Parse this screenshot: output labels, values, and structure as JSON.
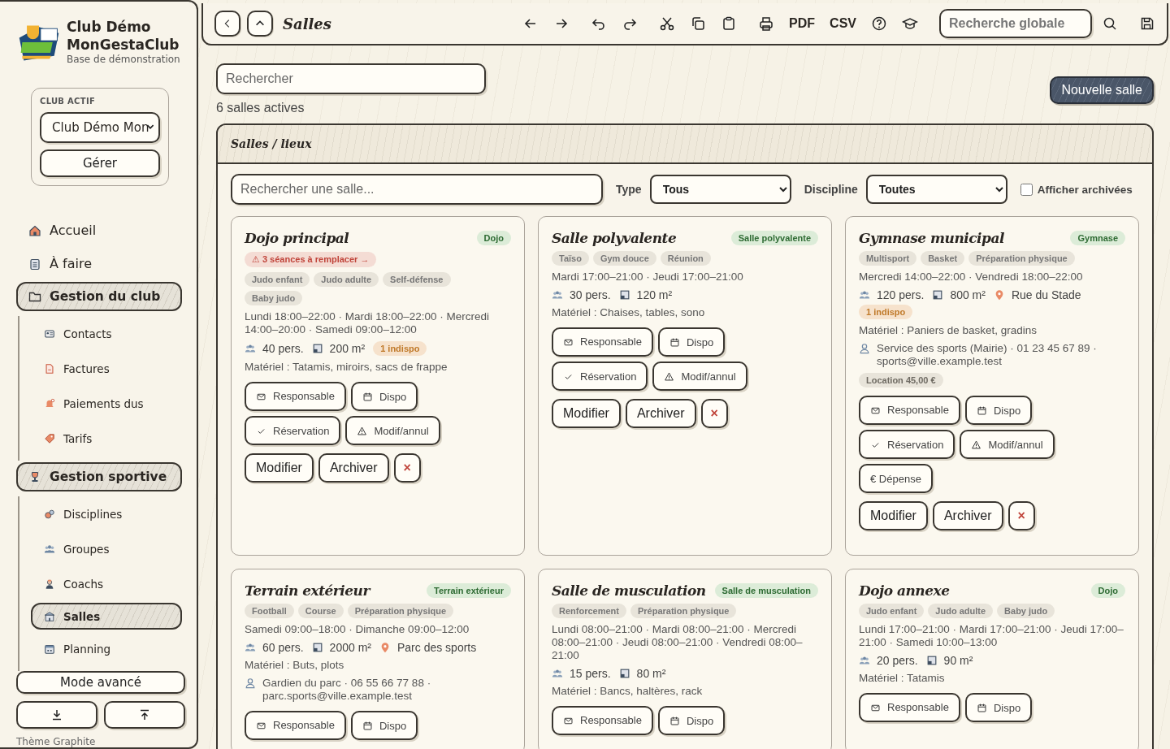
{
  "sidebar": {
    "brand": {
      "name": "Club Démo MonGestaClub",
      "subtitle": "Base de démonstration"
    },
    "active_club": {
      "label": "CLUB ACTIF",
      "value": "Club Démo Mon",
      "manage_button": "Gérer"
    },
    "nav": [
      {
        "kind": "link",
        "label": "Accueil",
        "selected": false
      },
      {
        "kind": "link",
        "label": "À faire",
        "selected": false
      },
      {
        "kind": "group",
        "label": "Gestion du club",
        "children": [
          {
            "label": "Contacts",
            "selected": false
          },
          {
            "label": "Factures",
            "selected": false
          },
          {
            "label": "Paiements dus",
            "selected": false
          },
          {
            "label": "Tarifs",
            "selected": false
          }
        ]
      },
      {
        "kind": "group",
        "label": "Gestion sportive",
        "children": [
          {
            "label": "Disciplines",
            "selected": false
          },
          {
            "label": "Groupes",
            "selected": false
          },
          {
            "label": "Coachs",
            "selected": false
          },
          {
            "label": "Salles",
            "selected": true
          },
          {
            "label": "Planning",
            "selected": false
          }
        ]
      }
    ],
    "mode_button": "Mode avancé",
    "theme": "Thème Graphite"
  },
  "toolbar": {
    "title": "Salles",
    "pdf": "PDF",
    "csv": "CSV",
    "search": {
      "placeholder": "Recherche globale"
    }
  },
  "page": {
    "search": {
      "placeholder": "Rechercher"
    },
    "count": "6 salles actives",
    "new_button": "Nouvelle salle"
  },
  "panel": {
    "title": "Salles / lieux",
    "search": {
      "placeholder": "Rechercher une salle..."
    },
    "type_label": "Type",
    "type_value": "Tous",
    "discipline_label": "Discipline",
    "discipline_value": "Toutes",
    "archived": {
      "label": "Afficher archivées",
      "checked": false
    },
    "cards": [
      {
        "name": "Dojo principal",
        "badge": "Dojo",
        "alert": "⚠ 3 séances à remplacer →",
        "tags": [
          "Judo enfant",
          "Judo adulte",
          "Self-défense",
          "Baby judo"
        ],
        "schedule": "Lundi 18:00–22:00 · Mardi 18:00–22:00 · Mercredi 14:00–20:00 · Samedi 09:00–12:00",
        "capacity": "40 pers.",
        "area": "200 m²",
        "unavailable": "1 indispo",
        "equipment": "Matériel : Tatamis, miroirs, sacs de frappe",
        "actions": [
          {
            "kind": "contact",
            "label": "Responsable"
          },
          {
            "kind": "availability",
            "label": "Dispo"
          },
          {
            "kind": "booking",
            "label": "Réservation"
          },
          {
            "kind": "change",
            "label": "Modif/annul"
          }
        ],
        "main_actions": [
          {
            "kind": "edit",
            "label": "Modifier"
          },
          {
            "kind": "archive",
            "label": "Archiver"
          },
          {
            "kind": "delete",
            "label": "×"
          }
        ]
      },
      {
        "name": "Salle polyvalente",
        "badge": "Salle polyvalente",
        "tags": [
          "Taïso",
          "Gym douce",
          "Réunion"
        ],
        "schedule": "Mardi 17:00–21:00 · Jeudi 17:00–21:00",
        "capacity": "30 pers.",
        "area": "120 m²",
        "equipment": "Matériel : Chaises, tables, sono",
        "actions": [
          {
            "kind": "contact",
            "label": "Responsable"
          },
          {
            "kind": "availability",
            "label": "Dispo"
          },
          {
            "kind": "booking",
            "label": "Réservation"
          },
          {
            "kind": "change",
            "label": "Modif/annul"
          }
        ],
        "main_actions": [
          {
            "kind": "edit",
            "label": "Modifier"
          },
          {
            "kind": "archive",
            "label": "Archiver"
          },
          {
            "kind": "delete",
            "label": "×"
          }
        ]
      },
      {
        "name": "Gymnase municipal",
        "badge": "Gymnase",
        "tags": [
          "Multisport",
          "Basket",
          "Préparation physique"
        ],
        "schedule": "Mercredi 14:00–22:00 · Vendredi 18:00–22:00",
        "capacity": "120 pers.",
        "area": "800 m²",
        "location": "Rue du Stade",
        "unavailable": "1 indispo",
        "equipment": "Matériel : Paniers de basket, gradins",
        "contact": "Service des sports (Mairie) · 01 23 45 67 89 · sports@ville.example.test",
        "price": "Location 45,00 €",
        "actions": [
          {
            "kind": "contact",
            "label": "Responsable"
          },
          {
            "kind": "availability",
            "label": "Dispo"
          },
          {
            "kind": "booking",
            "label": "Réservation"
          },
          {
            "kind": "change",
            "label": "Modif/annul"
          },
          {
            "kind": "expense",
            "label": "€ Dépense"
          }
        ],
        "main_actions": [
          {
            "kind": "edit",
            "label": "Modifier"
          },
          {
            "kind": "archive",
            "label": "Archiver"
          },
          {
            "kind": "delete",
            "label": "×"
          }
        ]
      },
      {
        "name": "Terrain extérieur",
        "badge": "Terrain extérieur",
        "tags": [
          "Football",
          "Course",
          "Préparation physique"
        ],
        "schedule": "Samedi 09:00–18:00 · Dimanche 09:00–12:00",
        "capacity": "60 pers.",
        "area": "2000 m²",
        "location": "Parc des sports",
        "equipment": "Matériel : Buts, plots",
        "contact": "Gardien du parc · 06 55 66 77 88 · parc.sports@ville.example.test",
        "actions": [
          {
            "kind": "contact",
            "label": "Responsable"
          },
          {
            "kind": "availability",
            "label": "Dispo"
          }
        ]
      },
      {
        "name": "Salle de musculation",
        "badge": "Salle de musculation",
        "tags": [
          "Renforcement",
          "Préparation physique"
        ],
        "schedule": "Lundi 08:00–21:00 · Mardi 08:00–21:00 · Mercredi 08:00–21:00 · Jeudi 08:00–21:00 · Vendredi 08:00–21:00",
        "capacity": "15 pers.",
        "area": "80 m²",
        "equipment": "Matériel : Bancs, haltères, rack",
        "actions": [
          {
            "kind": "contact",
            "label": "Responsable"
          },
          {
            "kind": "availability",
            "label": "Dispo"
          }
        ]
      },
      {
        "name": "Dojo annexe",
        "badge": "Dojo",
        "tags": [
          "Judo enfant",
          "Judo adulte",
          "Baby judo"
        ],
        "schedule": "Lundi 17:00–21:00 · Mardi 17:00–21:00 · Jeudi 17:00–21:00 · Samedi 10:00–13:00",
        "capacity": "20 pers.",
        "area": "90 m²",
        "equipment": "Matériel : Tatamis",
        "actions": [
          {
            "kind": "contact",
            "label": "Responsable"
          },
          {
            "kind": "availability",
            "label": "Dispo"
          }
        ]
      }
    ]
  }
}
